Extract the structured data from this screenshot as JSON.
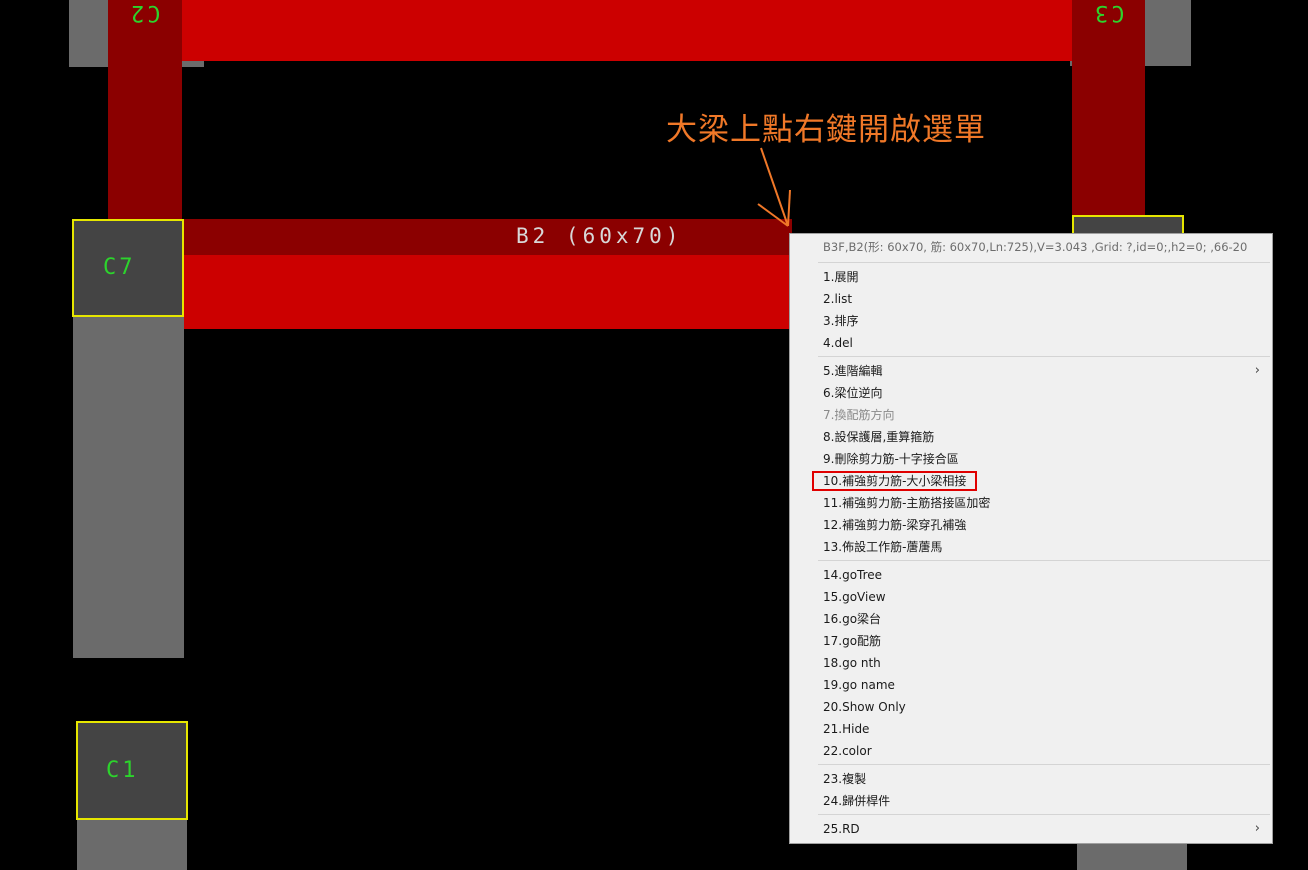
{
  "canvas": {
    "columns": {
      "c7": "C7",
      "c1": "C1",
      "c2_top_left": "C2",
      "c3_top_right": "C3"
    },
    "beam_label": "B2 (60x70)"
  },
  "annotation": {
    "text": "大梁上點右鍵開啟選單"
  },
  "context_menu": {
    "header": "B3F,B2(形: 60x70, 筋: 60x70,Ln:725),V=3.043 ,Grid: ?,id=0;,h2=0; ,66-20",
    "groups": [
      [
        {
          "label": "1.展開"
        },
        {
          "label": "2.list"
        },
        {
          "label": "3.排序"
        },
        {
          "label": "4.del"
        }
      ],
      [
        {
          "label": "5.進階編輯",
          "submenu": true
        },
        {
          "label": "6.梁位逆向"
        },
        {
          "label": "7.換配筋方向",
          "disabled": true
        },
        {
          "label": "8.設保護層,重算箍筋"
        },
        {
          "label": "9.刪除剪力筋-十字接合區"
        },
        {
          "label": "10.補強剪力筋-大小梁相接",
          "highlighted": true
        },
        {
          "label": "11.補強剪力筋-主筋搭接區加密"
        },
        {
          "label": "12.補強剪力筋-梁穿孔補強"
        },
        {
          "label": "13.佈設工作筋-蓎蓎馬"
        }
      ],
      [
        {
          "label": "14.goTree"
        },
        {
          "label": "15.goView"
        },
        {
          "label": "16.go梁台"
        },
        {
          "label": "17.go配筋"
        },
        {
          "label": "18.go nth"
        },
        {
          "label": "19.go name"
        },
        {
          "label": "20.Show Only"
        },
        {
          "label": "21.Hide"
        },
        {
          "label": "22.color"
        }
      ],
      [
        {
          "label": "23.複製"
        },
        {
          "label": "24.歸併桿件"
        }
      ],
      [
        {
          "label": "25.RD",
          "submenu": true
        }
      ]
    ],
    "submenu_arrow": "›"
  },
  "colors": {
    "beam_red": "#cc0000",
    "beam_dark_red": "#8b0000",
    "column_outline": "#e6e600",
    "column_label": "#2cd42c",
    "annotation": "#f07828",
    "highlight": "#e00000"
  }
}
